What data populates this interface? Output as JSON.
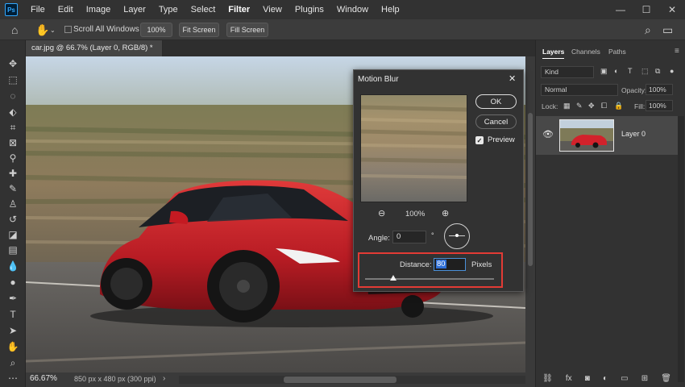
{
  "app": {
    "logo_text": "Ps"
  },
  "menu": {
    "items": [
      "File",
      "Edit",
      "Image",
      "Layer",
      "Type",
      "Select",
      "Filter",
      "View",
      "Plugins",
      "Window",
      "Help"
    ],
    "active": "Filter"
  },
  "window_controls": {
    "minimize": "—",
    "maximize": "☐",
    "close": "✕"
  },
  "options_bar": {
    "scroll_all_windows": "Scroll All Windows",
    "zoom_percent": "100%",
    "fit_screen": "Fit Screen",
    "fill_screen": "Fill Screen"
  },
  "document": {
    "tab_title": "car.jpg @ 66.7% (Layer 0, RGB/8) *",
    "tab_close": "✕"
  },
  "status_bar": {
    "zoom": "66.67%",
    "info": "850 px x 480 px (300 ppi)",
    "arrow": "›"
  },
  "dialog": {
    "title": "Motion Blur",
    "close": "✕",
    "ok": "OK",
    "cancel": "Cancel",
    "preview_label": "Preview",
    "preview_checked": true,
    "preview_zoom": "100%",
    "angle_label": "Angle:",
    "angle_value": "0",
    "degree_symbol": "°",
    "distance_label": "Distance:",
    "distance_value": "80",
    "distance_unit": "Pixels",
    "distance_slider_fraction": 0.22
  },
  "layers_panel": {
    "tabs": [
      "Layers",
      "Channels",
      "Paths"
    ],
    "active_tab": "Layers",
    "kind_filter": "Kind",
    "blend_mode": "Normal",
    "opacity_label": "Opacity:",
    "opacity_value": "100%",
    "lock_label": "Lock:",
    "fill_label": "Fill:",
    "fill_value": "100%",
    "layers": [
      {
        "name": "Layer 0",
        "visible": true
      }
    ]
  },
  "colors": {
    "menubar": "#323232",
    "panel": "#323232",
    "highlight": "#e23b35",
    "car_red": "#c8202a"
  }
}
